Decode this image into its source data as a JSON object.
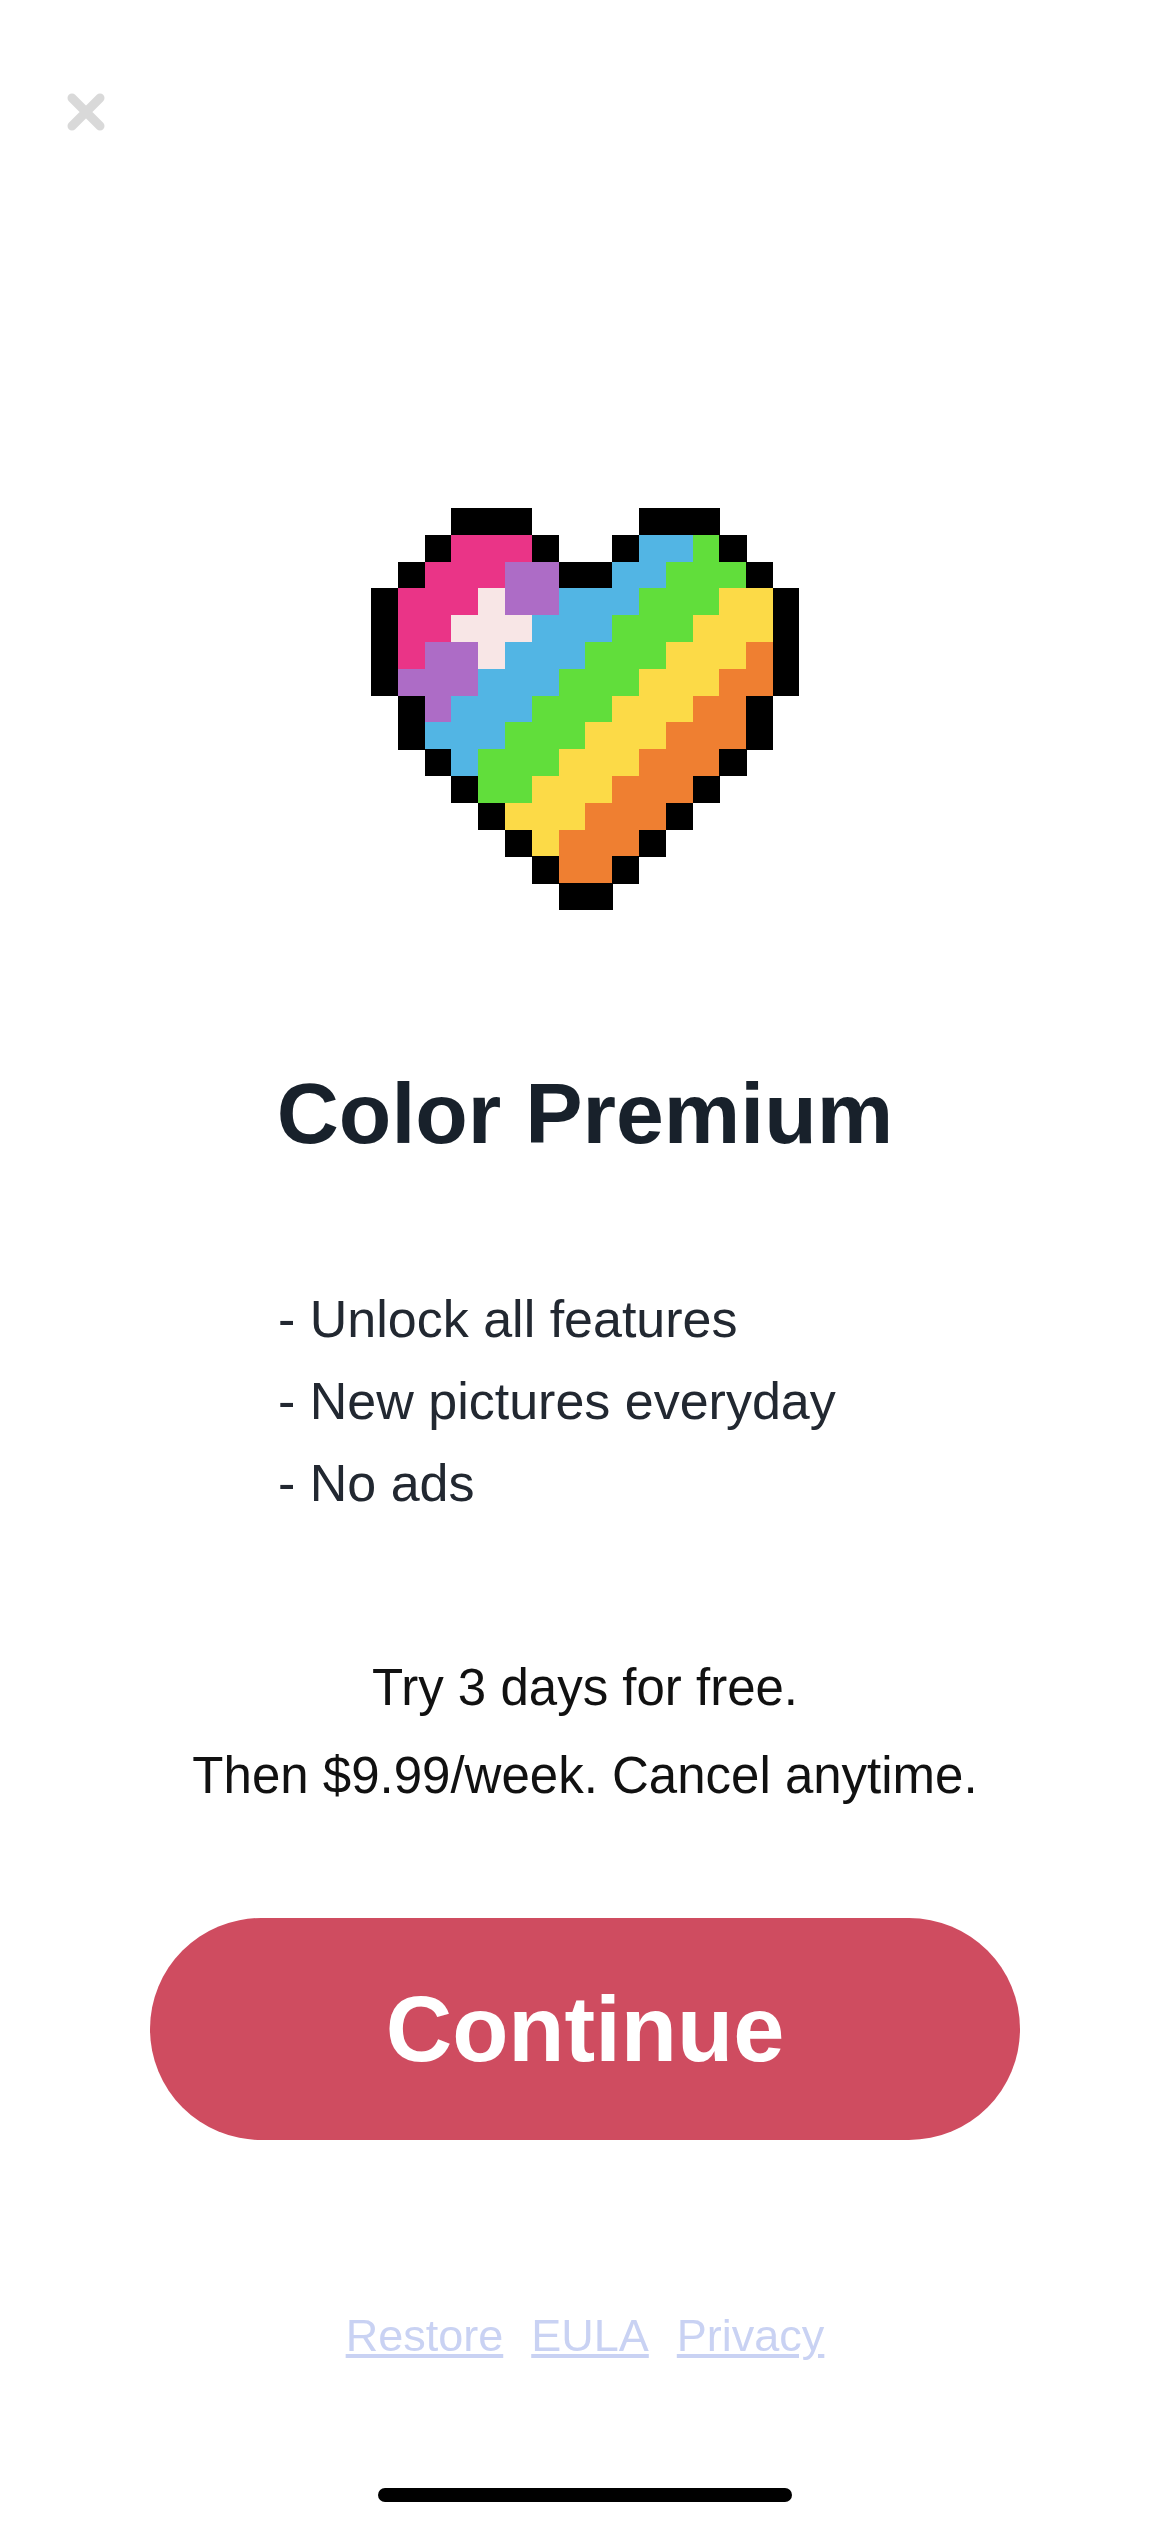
{
  "title": "Color Premium",
  "features": [
    "- Unlock all features",
    "- New pictures everyday",
    "- No ads"
  ],
  "offer": [
    "Try 3 days for free.",
    "Then $9.99/week. Cancel anytime."
  ],
  "button": {
    "label": "Continue"
  },
  "links": [
    "Restore",
    "EULA",
    "Privacy"
  ]
}
